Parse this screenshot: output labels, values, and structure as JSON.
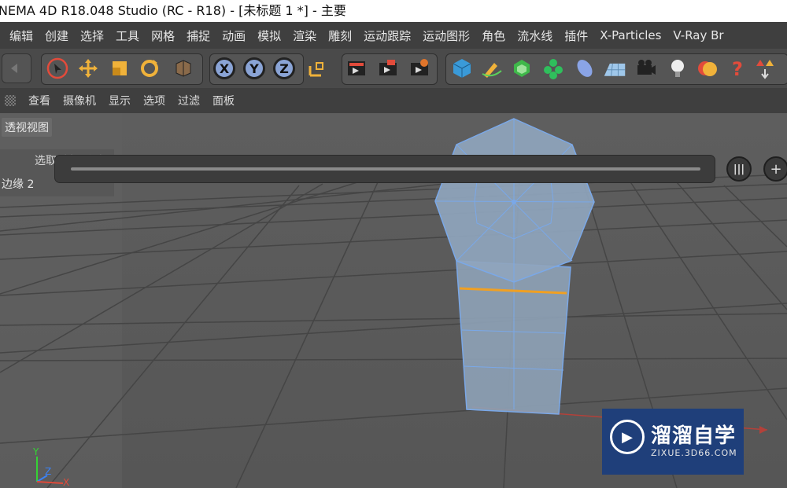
{
  "window": {
    "title": "NEMA 4D R18.048 Studio (RC - R18) - [未标题 1 *] - 主要"
  },
  "menubar": {
    "items": [
      "编辑",
      "创建",
      "选择",
      "工具",
      "网格",
      "捕捉",
      "动画",
      "模拟",
      "渲染",
      "雕刻",
      "运动跟踪",
      "运动图形",
      "角色",
      "流水线",
      "插件",
      "X-Particles",
      "V-Ray Br"
    ]
  },
  "toolbar": {
    "icons": [
      {
        "name": "undo-icon"
      },
      {
        "name": "select-icon"
      },
      {
        "name": "move-icon"
      },
      {
        "name": "scale-icon"
      },
      {
        "name": "rotate-icon"
      },
      {
        "name": "model-mode-icon"
      },
      {
        "name": "x-axis-lock",
        "label": "X"
      },
      {
        "name": "y-axis-lock",
        "label": "Y"
      },
      {
        "name": "z-axis-lock",
        "label": "Z"
      },
      {
        "name": "coordinate-system-icon"
      },
      {
        "name": "render-region-icon"
      },
      {
        "name": "render-view-icon"
      },
      {
        "name": "render-settings-icon"
      },
      {
        "name": "cube-icon"
      },
      {
        "name": "pen-icon"
      },
      {
        "name": "subdivision-icon"
      },
      {
        "name": "cloner-icon"
      },
      {
        "name": "deformer-icon"
      },
      {
        "name": "floor-icon"
      },
      {
        "name": "camera-icon"
      },
      {
        "name": "light-icon"
      },
      {
        "name": "material-icon"
      },
      {
        "name": "help-icon"
      },
      {
        "name": "tag-icon"
      }
    ]
  },
  "viewbar": {
    "items": [
      "查看",
      "摄像机",
      "显示",
      "选项",
      "过滤",
      "面板"
    ]
  },
  "viewport": {
    "label": "透视视图",
    "hud_label": "选取对象 总计",
    "hud_value": "边缘 2"
  },
  "watermark": {
    "title": "溜溜自学",
    "url": "ZIXUE.3D66.COM"
  },
  "axes": {
    "y": "Y",
    "z": "Z",
    "x": "X"
  },
  "colors": {
    "accent": "#8aa4d6",
    "selection": "#f0a023",
    "background": "#5a5a5a"
  }
}
